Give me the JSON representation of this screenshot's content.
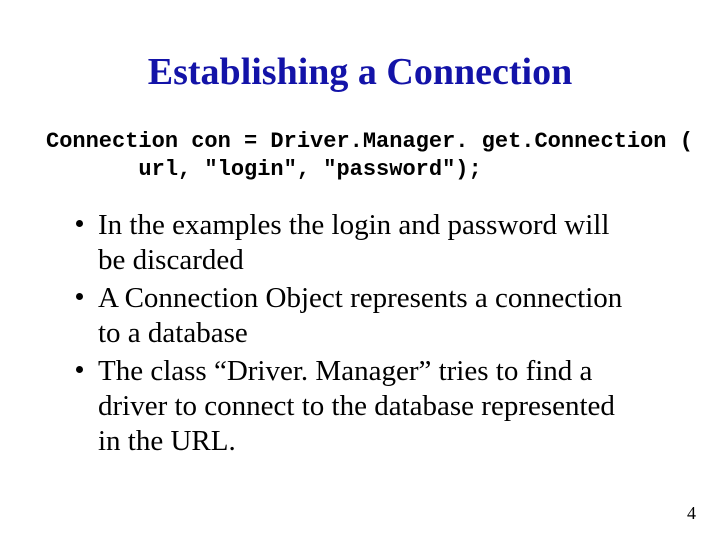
{
  "title": "Establishing a Connection",
  "code": {
    "line1": "Connection con = Driver.Manager. get.Connection (",
    "line2": "       url, \"login\", \"password\");"
  },
  "bullets": [
    "In the examples the login and password will be discarded",
    "A Connection Object represents a connection to a database",
    "The class “Driver. Manager” tries to find a driver to connect to the database represented in the URL."
  ],
  "pageNumber": "4"
}
